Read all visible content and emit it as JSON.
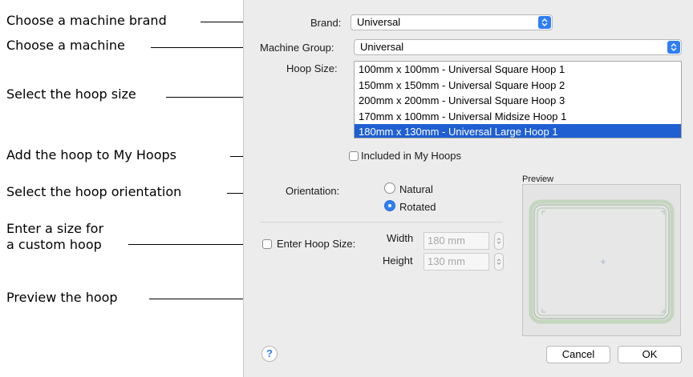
{
  "callouts": {
    "brand": "Choose a machine brand",
    "machine": "Choose a machine",
    "hoop_size": "Select the hoop size",
    "my_hoops": "Add the hoop to My Hoops",
    "orientation": "Select the hoop orientation",
    "custom_line1": "Enter a size for",
    "custom_line2": "a custom hoop",
    "preview": "Preview the hoop"
  },
  "dialog": {
    "brand_label": "Brand:",
    "brand_value": "Universal",
    "group_label": "Machine Group:",
    "group_value": "Universal",
    "hoop_size_label": "Hoop Size:",
    "hoops": [
      "100mm x 100mm - Universal Square Hoop 1",
      "150mm x 150mm - Universal Square Hoop 2",
      "200mm x 200mm -  Universal Square Hoop 3",
      "170mm x 100mm - Universal Midsize Hoop 1",
      "180mm x 130mm - Universal Large Hoop 1"
    ],
    "selected_hoop_index": 4,
    "my_hoops_label": "Included in My Hoops",
    "my_hoops_checked": false,
    "orientation_label": "Orientation:",
    "orientation_options": [
      "Natural",
      "Rotated"
    ],
    "orientation_selected": "Rotated",
    "enter_size_label": "Enter Hoop Size:",
    "enter_size_checked": false,
    "width_label": "Width",
    "width_value": "180 mm",
    "height_label": "Height",
    "height_value": "130 mm",
    "preview_label": "Preview",
    "help_glyph": "?",
    "cancel_label": "Cancel",
    "ok_label": "OK"
  },
  "colors": {
    "accent": "#2f7ef6",
    "selection": "#1f5fd1",
    "dialog_bg": "#ececec"
  }
}
